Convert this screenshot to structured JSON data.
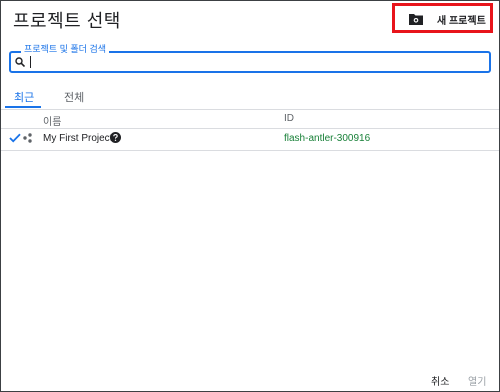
{
  "dialog": {
    "title": "프로젝트 선택",
    "new_project_label": "새 프로젝트"
  },
  "search": {
    "label": "프로젝트 및 폴더 검색",
    "value": ""
  },
  "tabs": [
    {
      "label": "최근",
      "active": true
    },
    {
      "label": "전체",
      "active": false
    }
  ],
  "table": {
    "columns": [
      "이름",
      "ID"
    ],
    "rows": [
      {
        "name": "My First Project",
        "id": "flash-antler-300916",
        "selected": true
      }
    ]
  },
  "footer": {
    "cancel_label": "취소",
    "open_label": "열기"
  },
  "colors": {
    "accent": "#1a73e8",
    "highlight_box": "#e8141b",
    "id_text": "#188038"
  },
  "icons": [
    "new-folder-icon",
    "search-icon",
    "check-icon",
    "project-icon",
    "help-icon"
  ]
}
